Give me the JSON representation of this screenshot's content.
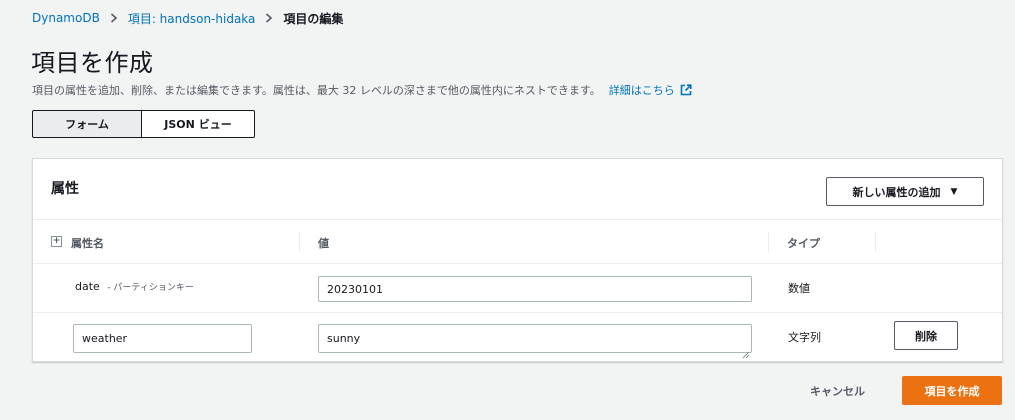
{
  "breadcrumb": {
    "items": [
      "DynamoDB",
      "項目: handson-hidaka"
    ],
    "current": "項目の編集",
    "separator_icon": "chevron-right-icon"
  },
  "page": {
    "title": "項目を作成",
    "description": "項目の属性を追加、削除、または編集できます。属性は、最大 32 レベルの深さまで他の属性内にネストできます。",
    "learn_more": "詳細はこちら",
    "learn_more_icon": "external-link-icon"
  },
  "view_toggle": {
    "form_label": "フォーム",
    "json_label": "JSON ビュー",
    "selected": "フォーム"
  },
  "attributes_panel": {
    "title": "属性",
    "add_button_label": "新しい属性の追加",
    "add_button_icon": "caret-down-icon",
    "columns": {
      "name": "属性名",
      "value": "値",
      "type": "タイプ"
    },
    "rows": [
      {
        "name": "date",
        "key_note": "- パーティションキー",
        "value": "20230101",
        "type": "数値"
      },
      {
        "name": "weather",
        "value": "sunny",
        "type": "文字列",
        "delete_label": "削除"
      }
    ]
  },
  "footer": {
    "cancel_label": "キャンセル",
    "create_label": "項目を作成"
  },
  "colors": {
    "link": "#0073bb",
    "primary_button": "#ec7211",
    "background": "#f2f3f3",
    "text": "#16191f"
  }
}
